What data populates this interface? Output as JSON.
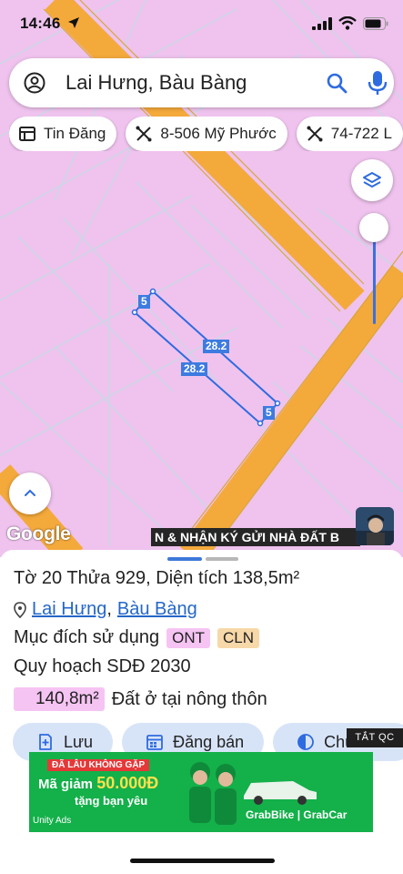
{
  "status": {
    "time": "14:46"
  },
  "search": {
    "query": "Lai Hưng, Bàu Bàng"
  },
  "chips": [
    {
      "label": "Tin Đăng",
      "icon": "listing-icon"
    },
    {
      "label": "8-506 Mỹ Phước",
      "icon": "route-icon"
    },
    {
      "label": "74-722 L",
      "icon": "route-icon"
    }
  ],
  "map": {
    "logo": "Google",
    "banner": "N & NHẬN KÝ GỬI NHÀ ĐẤT B",
    "parcel_labels": {
      "side_short": "5",
      "side_long": "28.2"
    }
  },
  "parcel": {
    "to_label": "Tờ",
    "to_value": "20",
    "thua_label": "Thửa",
    "thua_value": "929",
    "area_label": "Diện tích",
    "area_value": "138,5m²",
    "location_commune": "Lai Hưng",
    "location_separator": ",",
    "location_district": "Bàu Bàng",
    "purpose_label": "Mục đích sử dụng",
    "purpose_tags": [
      "ONT",
      "CLN"
    ],
    "planning_label": "Quy hoạch SDĐ 2030",
    "planning_area": "140,8m²",
    "planning_type": "Đất ở tại nông thôn"
  },
  "actions": [
    {
      "label": "Lưu",
      "icon": "bookmark-add-icon"
    },
    {
      "label": "Đăng bán",
      "icon": "calendar-icon"
    },
    {
      "label": "Chú thích",
      "icon": "half-circle-icon"
    }
  ],
  "ad": {
    "close_label": "TẮT QC",
    "headline": "ĐÃ LÂU KHÔNG GẶP",
    "promo_prefix": "Mã giảm",
    "promo_value": "50.000Đ",
    "promo_suffix": "tặng bạn yêu",
    "network": "Unity Ads",
    "brands": "GrabBike | GrabCar"
  },
  "colors": {
    "map_pink": "#efc3ee",
    "road_orange": "#f4a93b",
    "accent_blue": "#3c78d8"
  }
}
